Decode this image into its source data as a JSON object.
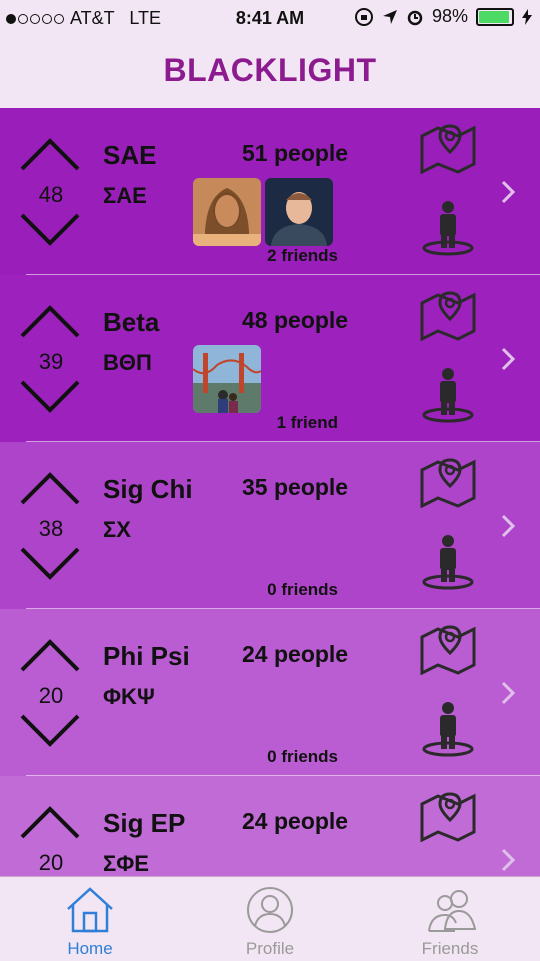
{
  "status_bar": {
    "carrier": "AT&T",
    "network": "LTE",
    "time": "8:41 AM",
    "battery": "98%",
    "signal_bars_filled": 1,
    "signal_bars_total": 5
  },
  "header": {
    "title": "BLACKLIGHT"
  },
  "icons": {
    "upvote": "chevron-up-icon",
    "downvote": "chevron-down-icon",
    "map": "map-pin-icon",
    "person_location": "person-location-icon",
    "disclosure": "chevron-right-icon"
  },
  "rows": [
    {
      "name": "SAE",
      "letters": "ΣΑΕ",
      "score": "48",
      "people": "51 people",
      "friends": "2 friends",
      "bg": "#9a1fba"
    },
    {
      "name": "Beta",
      "letters": "ΒΘΠ",
      "score": "39",
      "people": "48 people",
      "friends": "1 friend",
      "bg": "#9d22bd"
    },
    {
      "name": "Sig Chi",
      "letters": "ΣΧ",
      "score": "38",
      "people": "35 people",
      "friends": "0 friends",
      "bg": "#ae44c9"
    },
    {
      "name": "Phi Psi",
      "letters": "ΦΚΨ",
      "score": "20",
      "people": "24 people",
      "friends": "0 friends",
      "bg": "#ba5cd2"
    },
    {
      "name": "Sig EP",
      "letters": "ΣΦΕ",
      "score": "20",
      "people": "24 people",
      "friends": "",
      "bg": "#c16bd7"
    }
  ],
  "tabs": [
    {
      "label": "Home",
      "icon": "home-icon",
      "active": true
    },
    {
      "label": "Profile",
      "icon": "profile-icon",
      "active": false
    },
    {
      "label": "Friends",
      "icon": "friends-icon",
      "active": false
    }
  ],
  "colors": {
    "title": "#8b1b8e",
    "tab_active": "#2f7fd8",
    "tab_inactive": "#9a9a9a",
    "bars_background": "#f3e6f4"
  }
}
